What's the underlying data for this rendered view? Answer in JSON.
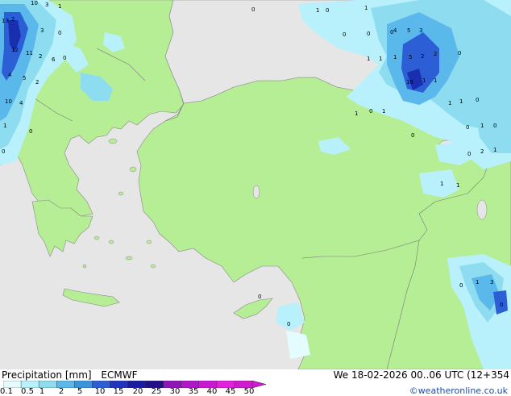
{
  "title": "Precipitation [mm]",
  "model": "ECMWF",
  "datetime": "We 18-02-2026 00..06 UTC (12+354",
  "credit": "©weatheronline.co.uk",
  "colors": {
    "sea": "#e6e6e6",
    "land": "#b5ee94",
    "light_blue": "#b8f1fb",
    "mid_blue": "#8edcf0",
    "blue": "#5ab8ea",
    "dark_blue": "#2c5fd6",
    "navy": "#1a2fb0"
  },
  "legend": {
    "ticks": [
      "0.1",
      "0.5",
      "1",
      "2",
      "5",
      "10",
      "15",
      "20",
      "25",
      "30",
      "35",
      "40",
      "45",
      "50"
    ],
    "colors": [
      "#e4fcfd",
      "#b8f1fb",
      "#8edcf0",
      "#5ab8ea",
      "#3a95dd",
      "#2c5fd6",
      "#2034c0",
      "#1a1ba5",
      "#240f8a",
      "#8f15b8",
      "#b017c8",
      "#cc18d4",
      "#e51fdf",
      "#d01ad0"
    ]
  },
  "map_values": [
    "10",
    "3",
    "1",
    "13",
    "2",
    "3",
    "0",
    "12",
    "11",
    "2",
    "0",
    "6",
    "4",
    "5",
    "2",
    "10",
    "4",
    "1",
    "0",
    "0",
    "0",
    "1",
    "0",
    "1",
    "0",
    "0",
    "0",
    "4",
    "5",
    "3",
    "1",
    "1",
    "1",
    "5",
    "2",
    "2",
    "0",
    "16",
    "1",
    "1",
    "1",
    "0",
    "1",
    "0",
    "1",
    "1",
    "0",
    "0",
    "1",
    "0",
    "2",
    "1",
    "0",
    "1",
    "1",
    "1",
    "3",
    "0",
    "0",
    "0",
    "0"
  ]
}
